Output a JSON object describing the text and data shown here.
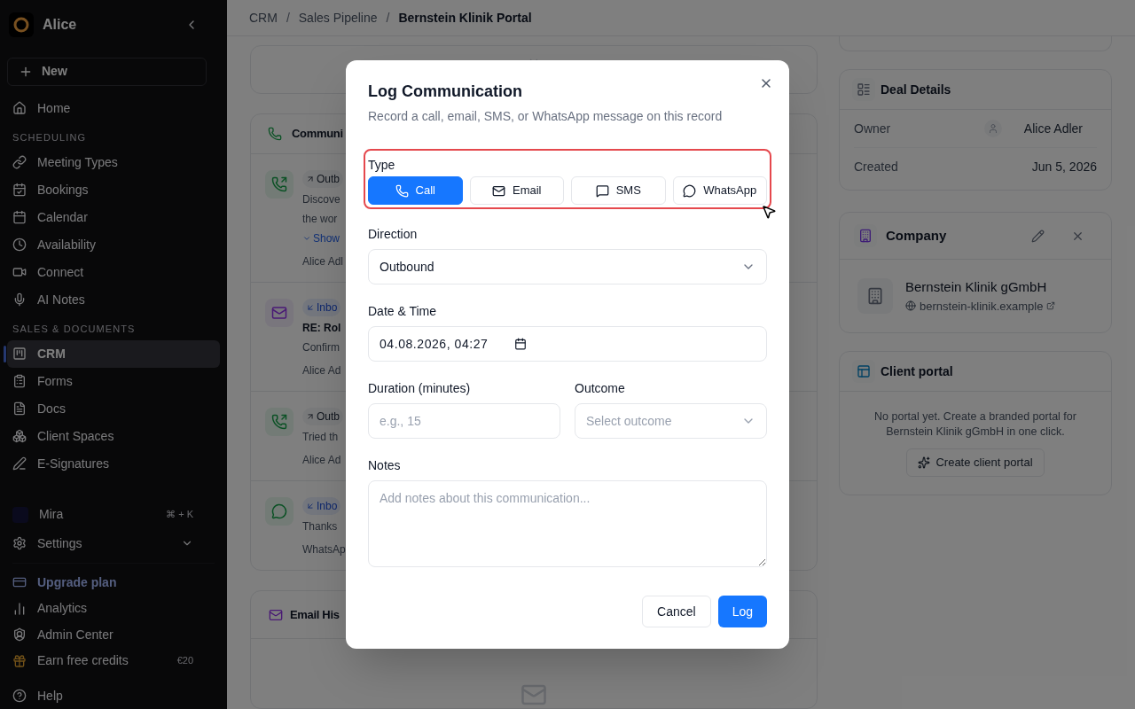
{
  "sidebar": {
    "workspace": "Alice",
    "new_button": "New",
    "groups": [
      {
        "items": [
          {
            "label": "Home",
            "selected": false
          }
        ]
      },
      {
        "heading": "SCHEDULING",
        "items": [
          {
            "label": "Meeting Types",
            "selected": false
          },
          {
            "label": "Bookings",
            "selected": false
          },
          {
            "label": "Calendar",
            "selected": false
          },
          {
            "label": "Availability",
            "selected": false
          },
          {
            "label": "Connect",
            "selected": false
          },
          {
            "label": "AI Notes",
            "selected": false
          }
        ]
      },
      {
        "heading": "SALES & DOCUMENTS",
        "items": [
          {
            "label": "CRM",
            "selected": true
          },
          {
            "label": "Forms",
            "selected": false
          },
          {
            "label": "Docs",
            "selected": false
          },
          {
            "label": "Client Spaces",
            "selected": false
          },
          {
            "label": "E-Signatures",
            "selected": false
          }
        ]
      }
    ],
    "assistant": {
      "label": "Mira",
      "shortcut": "⌘ + K"
    },
    "settings": {
      "label": "Settings"
    },
    "footer": [
      {
        "kind": "upgrade",
        "label": "Upgrade plan"
      },
      {
        "kind": "item",
        "label": "Analytics"
      },
      {
        "kind": "item",
        "label": "Admin Center"
      },
      {
        "kind": "credits",
        "label": "Earn free credits",
        "badge": "€20"
      },
      {
        "kind": "item",
        "label": "Help"
      }
    ]
  },
  "breadcrumb": {
    "separator": "/",
    "items": [
      "CRM",
      "Sales Pipeline",
      "Bernstein Klinik Portal"
    ]
  },
  "communications": {
    "title": "Communi",
    "entries": [
      {
        "kind": "call",
        "badge": {
          "kind": "outbound",
          "label": "Outb"
        },
        "lines": [
          "Discove",
          "the wor"
        ],
        "show_more": "Show",
        "meta": "Alice Adl"
      },
      {
        "kind": "email",
        "badge": {
          "kind": "inbound",
          "label": "Inbo"
        },
        "title": "RE: Rol",
        "lines": [
          "Confirm"
        ],
        "meta": "Alice Ad"
      },
      {
        "kind": "call",
        "badge": {
          "kind": "outbound",
          "label": "Outb"
        },
        "lines": [
          "Tried th"
        ],
        "meta": "Alice Ad"
      },
      {
        "kind": "whatsapp",
        "badge": {
          "kind": "inbound",
          "label": "Inbo"
        },
        "lines": [
          "Thanks"
        ],
        "meta": "WhatsAp"
      }
    ]
  },
  "email_history": {
    "title": "Email His"
  },
  "deal_details": {
    "title": "Deal Details",
    "rows": [
      {
        "kind": "owner",
        "label": "Owner",
        "value": "Alice Adler"
      },
      {
        "kind": "text",
        "label": "Created",
        "value": "Jun 5, 2026"
      }
    ]
  },
  "company": {
    "title": "Company",
    "name": "Bernstein Klinik gGmbH",
    "website": "bernstein-klinik.example"
  },
  "client_portal": {
    "title": "Client portal",
    "message": "No portal yet. Create a branded portal for Bernstein Klinik gGmbH in one click.",
    "button": "Create client portal"
  },
  "dialog": {
    "title": "Log Communication",
    "subtitle": "Record a call, email, SMS, or WhatsApp message on this record",
    "type": {
      "label": "Type",
      "highlighted": true,
      "options": [
        {
          "kind": "call",
          "label": "Call",
          "selected": true
        },
        {
          "kind": "email",
          "label": "Email",
          "selected": false
        },
        {
          "kind": "sms",
          "label": "SMS",
          "selected": false
        },
        {
          "kind": "whatsapp",
          "label": "WhatsApp",
          "selected": false
        }
      ]
    },
    "direction": {
      "label": "Direction",
      "value": "Outbound"
    },
    "date_time": {
      "label": "Date & Time",
      "value": "04.08.2026, 04:27"
    },
    "duration": {
      "label": "Duration (minutes)",
      "placeholder": "e.g., 15"
    },
    "outcome": {
      "label": "Outcome",
      "placeholder": "Select outcome"
    },
    "notes": {
      "label": "Notes",
      "placeholder": "Add notes about this communication..."
    },
    "buttons": [
      {
        "kind": "secondary",
        "label": "Cancel"
      },
      {
        "kind": "primary",
        "label": "Log"
      }
    ]
  }
}
